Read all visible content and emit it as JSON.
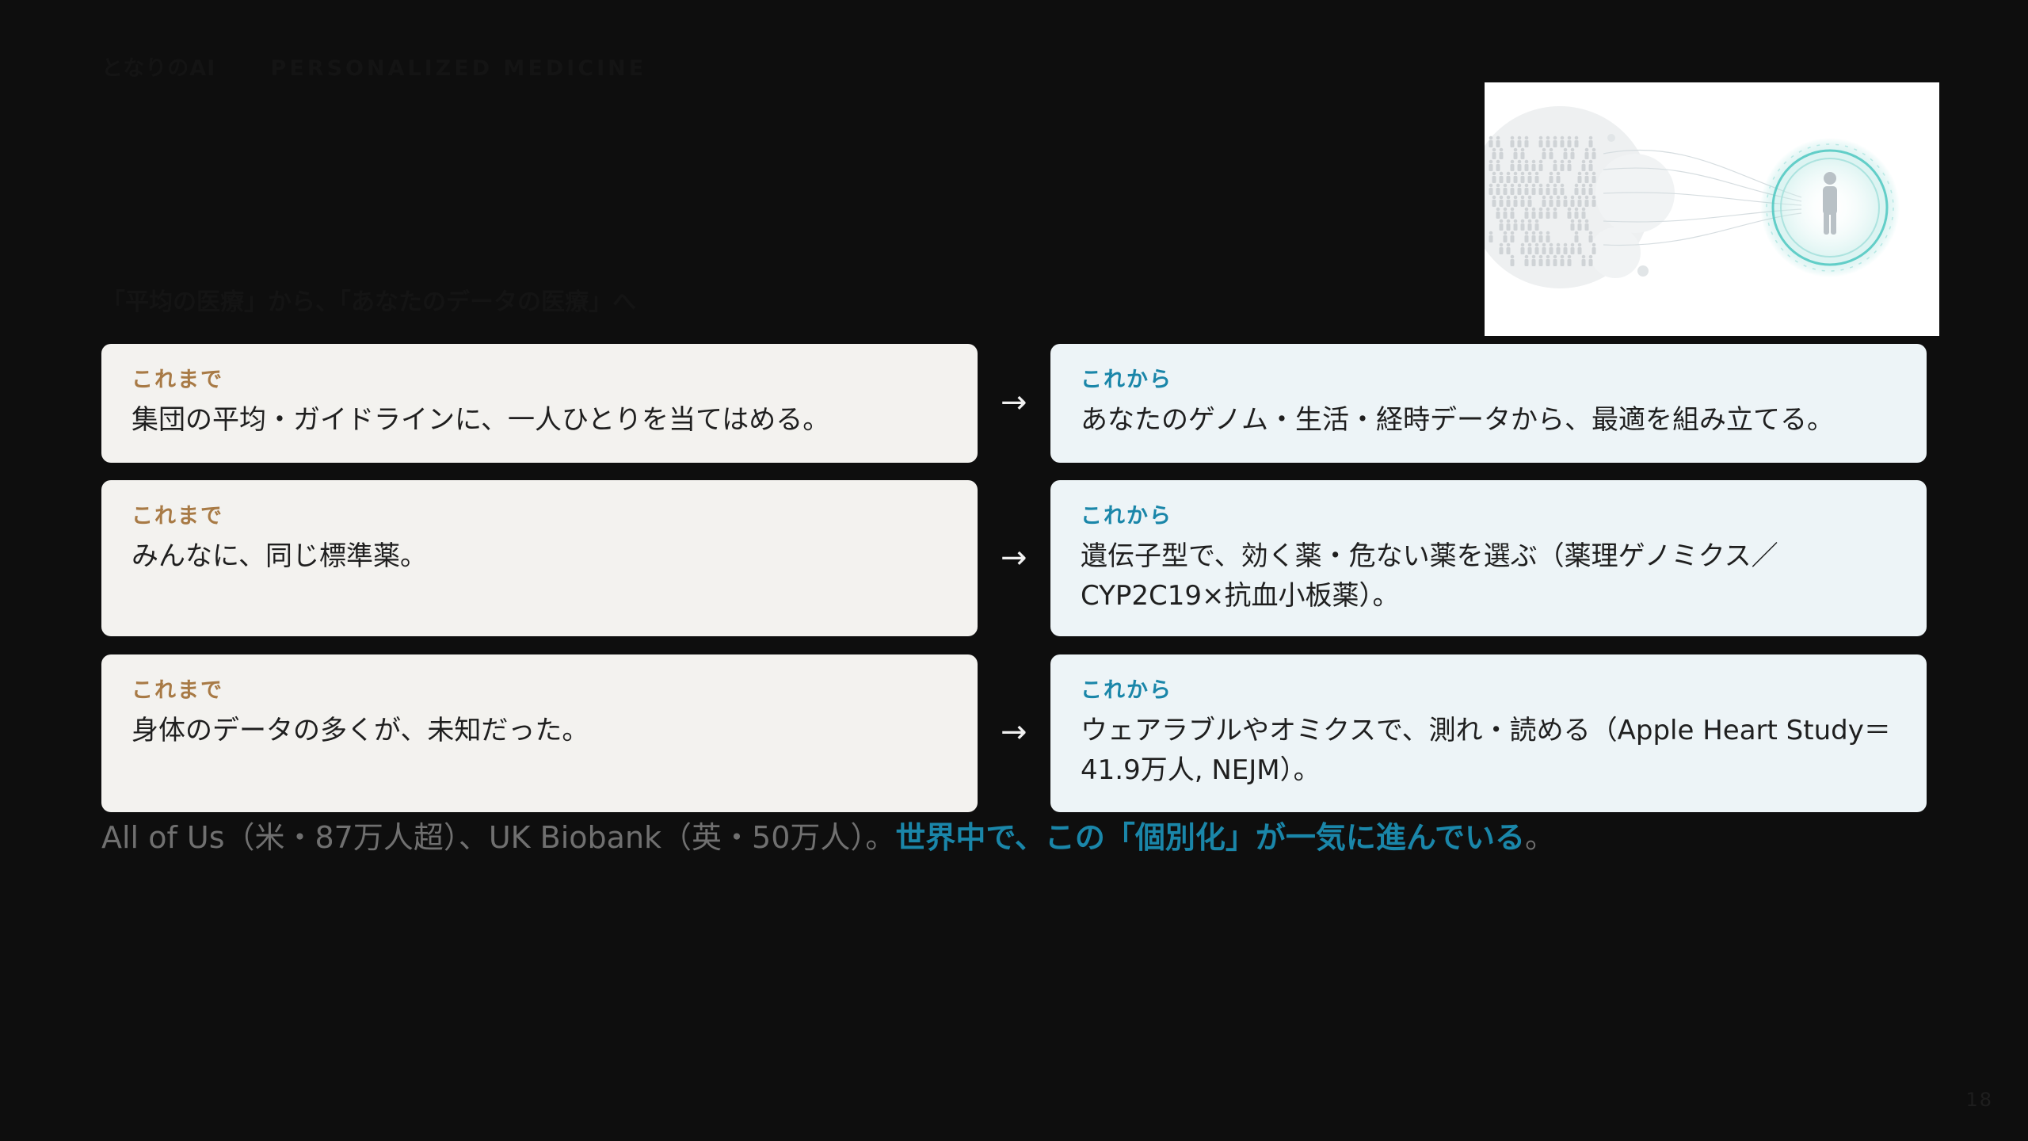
{
  "header": {
    "brand": "となりのAI",
    "section": "PERSONALIZED MEDICINE"
  },
  "hero_image": {
    "icon": "person-in-circle-icon",
    "description_colors": {
      "crowd": "#cfd3d6",
      "ring": "#4cc7bf"
    }
  },
  "subtitle": "「平均の医療」から、「あなたのデータの医療」へ",
  "arrow_glyph": "→",
  "rows": [
    {
      "before": {
        "tag": "これまで",
        "text": "集団の平均・ガイドラインに、一人ひとりを当てはめる。"
      },
      "after": {
        "tag": "これから",
        "text": "あなたのゲノム・生活・経時データから、最適を組み立てる。"
      }
    },
    {
      "before": {
        "tag": "これまで",
        "text": "みんなに、同じ標準薬。"
      },
      "after": {
        "tag": "これから",
        "text": "遺伝子型で、効く薬・危ない薬を選ぶ（薬理ゲノミクス／CYP2C19×抗血小板薬）。"
      }
    },
    {
      "before": {
        "tag": "これまで",
        "text": "身体のデータの多くが、未知だった。"
      },
      "after": {
        "tag": "これから",
        "text": "ウェアラブルやオミクスで、測れ・読める（Apple Heart Study＝41.9万人, NEJM）。"
      }
    }
  ],
  "footer": {
    "plain": "All of Us（米・87万人超）、UK Biobank（英・50万人）。",
    "highlight": "世界中で、この「個別化」が一気に進んでいる",
    "end": "。"
  },
  "page_number": "18",
  "colors": {
    "background": "#0e0e0e",
    "accent_blue": "#1a86a9",
    "accent_gold": "#a87a45"
  }
}
